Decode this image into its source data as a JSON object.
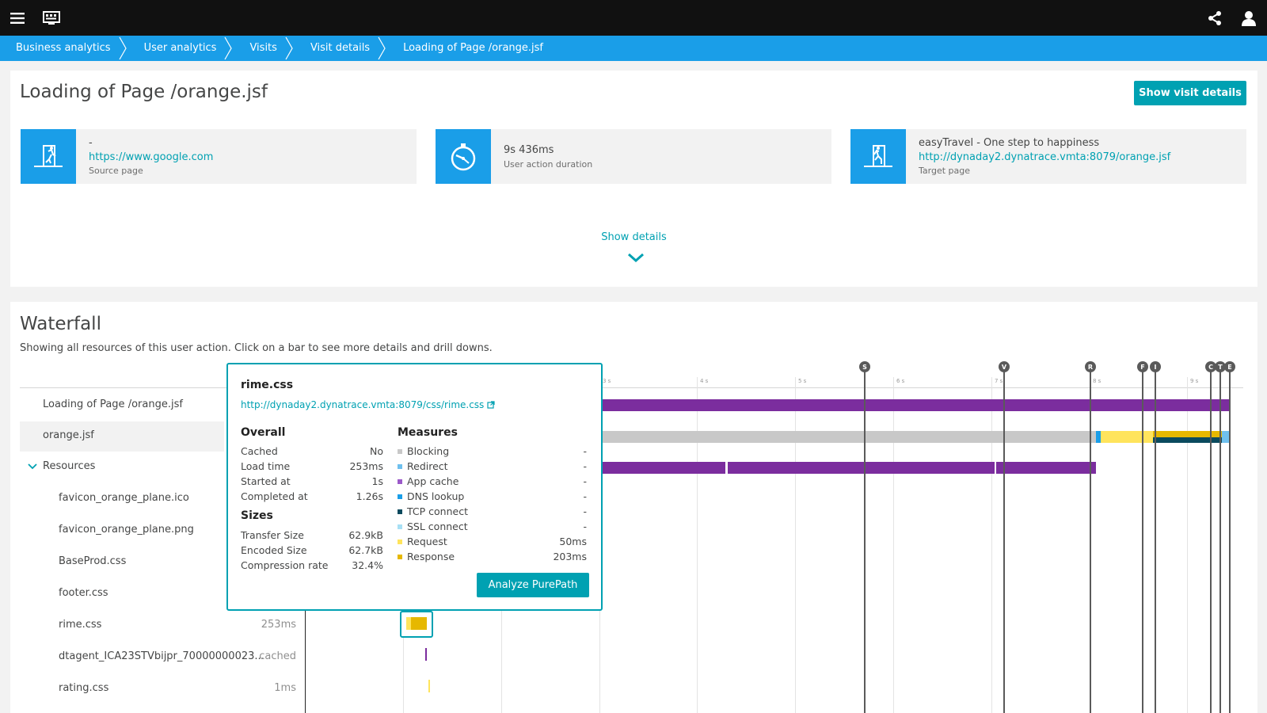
{
  "topbar": {
    "menu_icon": "hamburger-menu-icon",
    "monitor_icon": "monitor-icon",
    "share_icon": "share-icon",
    "user_icon": "user-icon"
  },
  "breadcrumb": [
    "Business analytics",
    "User analytics",
    "Visits",
    "Visit details",
    "Loading of Page /orange.jsf"
  ],
  "header": {
    "title": "Loading of Page /orange.jsf",
    "show_visit_details": "Show visit details"
  },
  "tiles": [
    {
      "line1": "-",
      "link": "https://www.google.com",
      "caption": "Source page",
      "icon": "exit-door-icon"
    },
    {
      "value": "9s 436ms",
      "caption": "User action duration",
      "icon": "stopwatch-icon"
    },
    {
      "line1": "easyTravel - One step to happiness",
      "link": "http://dynaday2.dynatrace.vmta:8079/orange.jsf",
      "caption": "Target page",
      "icon": "enter-door-icon"
    }
  ],
  "show_details": "Show details",
  "waterfall": {
    "title": "Waterfall",
    "description": "Showing all resources of this user action. Click on a bar to see more details and drill downs.",
    "rows": [
      {
        "label": "Loading of Page /orange.jsf",
        "value": ""
      },
      {
        "label": "orange.jsf",
        "value": ""
      },
      {
        "label": "Resources",
        "value": ""
      },
      {
        "label": "favicon_orange_plane.ico",
        "value": ""
      },
      {
        "label": "favicon_orange_plane.png",
        "value": ""
      },
      {
        "label": "BaseProd.css",
        "value": ""
      },
      {
        "label": "footer.css",
        "value": ""
      },
      {
        "label": "rime.css",
        "value": "253ms"
      },
      {
        "label": "dtagent_ICA23STVbijpr_70000000023...",
        "value": "cached"
      },
      {
        "label": "rating.css",
        "value": "1ms"
      }
    ],
    "ticks": [
      "3 s",
      "4 s",
      "5 s",
      "6 s",
      "7 s",
      "8 s",
      "9 s"
    ],
    "markers": [
      "S",
      "V",
      "R",
      "F",
      "I",
      "C",
      "T",
      "E"
    ],
    "colors": {
      "purple": "#7b2d9e",
      "gray": "#c8c8c8",
      "yellow": "#ffe45c",
      "dark_yellow": "#e6b800",
      "dark_teal": "#0b4a5e",
      "light_blue": "#6fc0ee",
      "blue": "#1a9ee8"
    }
  },
  "popup": {
    "title": "rime.css",
    "link": "http://dynaday2.dynatrace.vmta:8079/css/rime.css",
    "overall_heading": "Overall",
    "overall": [
      {
        "k": "Cached",
        "v": "No"
      },
      {
        "k": "Load time",
        "v": "253ms"
      },
      {
        "k": "Started at",
        "v": "1s"
      },
      {
        "k": "Completed at",
        "v": "1.26s"
      }
    ],
    "sizes_heading": "Sizes",
    "sizes": [
      {
        "k": "Transfer Size",
        "v": "62.9kB"
      },
      {
        "k": "Encoded Size",
        "v": "62.7kB"
      },
      {
        "k": "Compression rate",
        "v": "32.4%"
      }
    ],
    "measures_heading": "Measures",
    "measures": [
      {
        "k": "Blocking",
        "v": "-",
        "color": "#c8c8c8"
      },
      {
        "k": "Redirect",
        "v": "-",
        "color": "#6fc0ee"
      },
      {
        "k": "App cache",
        "v": "-",
        "color": "#9b59c9"
      },
      {
        "k": "DNS lookup",
        "v": "-",
        "color": "#1a9ee8"
      },
      {
        "k": "TCP connect",
        "v": "-",
        "color": "#0b4a5e"
      },
      {
        "k": "SSL connect",
        "v": "-",
        "color": "#a8e0f5"
      },
      {
        "k": "Request",
        "v": "50ms",
        "color": "#ffe45c"
      },
      {
        "k": "Response",
        "v": "203ms",
        "color": "#e6b800"
      }
    ],
    "button": "Analyze PurePath"
  }
}
